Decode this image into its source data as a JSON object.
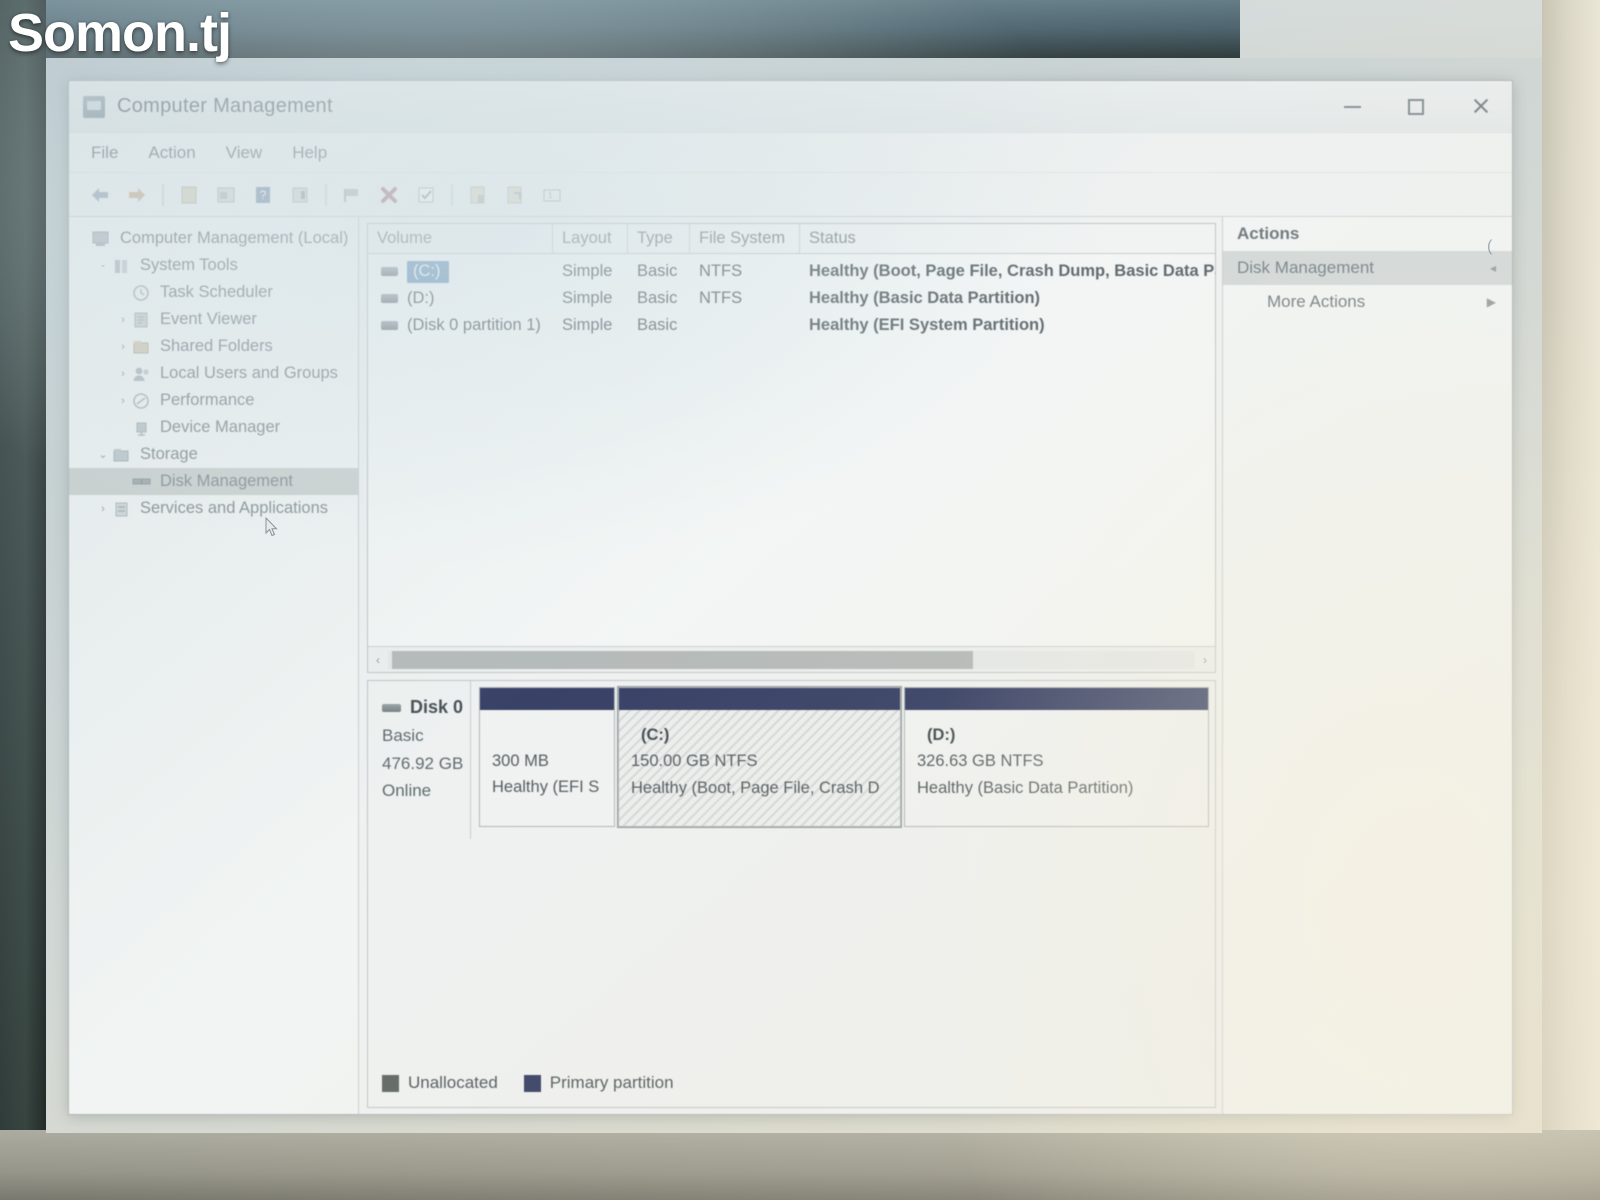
{
  "watermark": "Somon.tj",
  "window": {
    "title": "Computer Management",
    "icon": "computer-management-icon",
    "controls": {
      "minimize": "–",
      "maximize": "□",
      "close": "✕"
    }
  },
  "menu": {
    "items": [
      "File",
      "Action",
      "View",
      "Help"
    ]
  },
  "toolbar": {
    "icons": [
      "back-arrow-icon",
      "forward-arrow-icon",
      "up-folder-icon",
      "properties-icon",
      "help-icon",
      "show-hide-console-tree-icon",
      "flag-icon",
      "delete-icon",
      "check-icon",
      "new-volume-icon",
      "rescan-disks-icon",
      "console-icon"
    ]
  },
  "tree": {
    "root": {
      "label": "Computer Management (Local)",
      "icon": "computer-icon"
    },
    "items": [
      {
        "label": "System Tools",
        "icon": "system-tools-icon",
        "twisty": "-",
        "indent": 1,
        "selected": false
      },
      {
        "label": "Task Scheduler",
        "icon": "task-scheduler-icon",
        "twisty": "",
        "indent": 2,
        "selected": false
      },
      {
        "label": "Event Viewer",
        "icon": "event-viewer-icon",
        "twisty": "›",
        "indent": 2,
        "selected": false
      },
      {
        "label": "Shared Folders",
        "icon": "shared-folders-icon",
        "twisty": "›",
        "indent": 2,
        "selected": false
      },
      {
        "label": "Local Users and Groups",
        "icon": "local-users-icon",
        "twisty": "›",
        "indent": 2,
        "selected": false
      },
      {
        "label": "Performance",
        "icon": "performance-icon",
        "twisty": "›",
        "indent": 2,
        "selected": false
      },
      {
        "label": "Device Manager",
        "icon": "device-manager-icon",
        "twisty": "",
        "indent": 2,
        "selected": false
      },
      {
        "label": "Storage",
        "icon": "storage-icon",
        "twisty": "⌄",
        "indent": 1,
        "selected": false
      },
      {
        "label": "Disk Management",
        "icon": "disk-management-icon",
        "twisty": "",
        "indent": 2,
        "selected": true
      },
      {
        "label": "Services and Applications",
        "icon": "services-icon",
        "twisty": "›",
        "indent": 1,
        "selected": false
      }
    ]
  },
  "volume_list": {
    "columns": [
      "Volume",
      "Layout",
      "Type",
      "File System",
      "Status"
    ],
    "rows": [
      {
        "volume": "(C:)",
        "layout": "Simple",
        "type": "Basic",
        "file_system": "NTFS",
        "status": "Healthy (Boot, Page File, Crash Dump, Basic Data Partition",
        "selected": true
      },
      {
        "volume": "(D:)",
        "layout": "Simple",
        "type": "Basic",
        "file_system": "NTFS",
        "status": "Healthy (Basic Data Partition)",
        "selected": false
      },
      {
        "volume": "(Disk 0 partition 1)",
        "layout": "Simple",
        "type": "Basic",
        "file_system": "",
        "status": "Healthy (EFI System Partition)",
        "selected": false
      }
    ]
  },
  "disk_view": {
    "disk": {
      "name": "Disk 0",
      "type": "Basic",
      "capacity": "476.92 GB",
      "state": "Online"
    },
    "partitions": [
      {
        "name": "",
        "size": "300 MB",
        "status": "Healthy (EFI S",
        "selected": false
      },
      {
        "name": "(C:)",
        "size": "150.00 GB NTFS",
        "status": "Healthy (Boot, Page File, Crash D",
        "selected": true
      },
      {
        "name": "(D:)",
        "size": "326.63 GB NTFS",
        "status": "Healthy (Basic Data Partition)",
        "selected": false
      }
    ]
  },
  "legend": {
    "items": [
      {
        "label": "Unallocated",
        "color": "#4c5b50"
      },
      {
        "label": "Primary partition",
        "color": "#1e2d6e"
      }
    ]
  },
  "actions": {
    "header": "Actions",
    "selected_item": "Disk Management",
    "items": [
      "More Actions"
    ],
    "chevron": "▶"
  },
  "scrollbar": {
    "left_arrow": "‹",
    "right_arrow": "›"
  }
}
